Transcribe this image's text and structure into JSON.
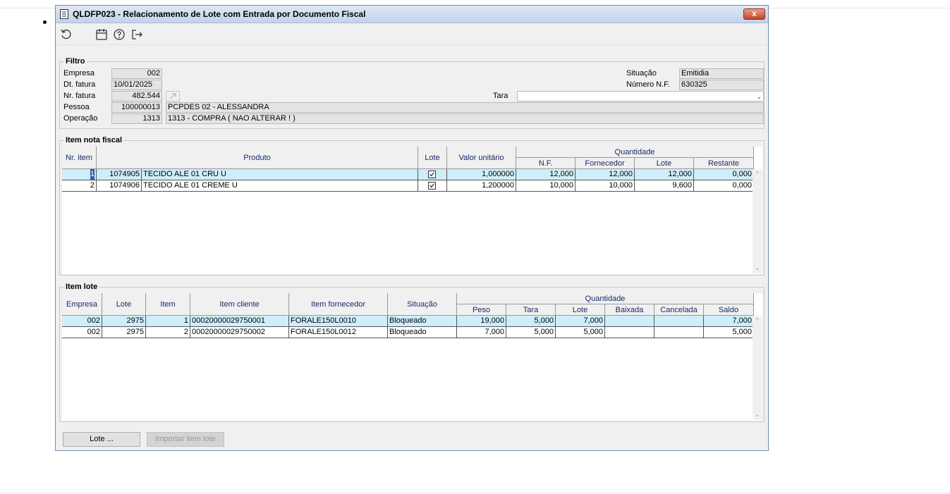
{
  "window": {
    "title": "QLDFP023 - Relacionamento de Lote com Entrada por Documento Fiscal",
    "close_label": "x"
  },
  "toolbar": {
    "icons": [
      "refresh-icon",
      "calendar-icon",
      "help-icon",
      "exit-icon"
    ]
  },
  "filtro": {
    "label": "Filtro",
    "empresa_label": "Empresa",
    "empresa": "002",
    "dt_fatura_label": "Dt. fatura",
    "dt_fatura": "10/01/2025",
    "nr_fatura_label": "Nr. fatura",
    "nr_fatura": "482.544",
    "pessoa_label": "Pessoa",
    "pessoa_code": "100000013",
    "pessoa_name": "PCPDES 02 - ALESSANDRA",
    "operacao_label": "Operação",
    "operacao_code": "1313",
    "operacao_name": "1313 - COMPRA ( NAO ALTERAR ! )",
    "situacao_label": "Situação",
    "situacao": "Emitidia",
    "numero_nf_label": "Número N.F.",
    "numero_nf": "630325",
    "tara_label": "Tara",
    "tara": ""
  },
  "item_nota": {
    "label": "Item nota fiscal",
    "headers": {
      "nr_item": "Nr. item",
      "produto": "Produto",
      "lote": "Lote",
      "valor_unitario": "Valor unitário",
      "quantidade": "Quantidade",
      "nf": "N.F.",
      "fornecedor": "Fornecedor",
      "q_lote": "Lote",
      "restante": "Restante"
    },
    "rows": [
      {
        "nr": "1",
        "cod": "1074905",
        "desc": "TECIDO ALE 01 CRU U",
        "valor": "1,000000",
        "nf": "12,000",
        "fornecedor": "12,000",
        "lote": "12,000",
        "restante": "0,000"
      },
      {
        "nr": "2",
        "cod": "1074906",
        "desc": "TECIDO ALE 01 CREME U",
        "valor": "1,200000",
        "nf": "10,000",
        "fornecedor": "10,000",
        "lote": "9,600",
        "restante": "0,000"
      }
    ]
  },
  "item_lote": {
    "label": "Item lote",
    "headers": {
      "empresa": "Empresa",
      "lote": "Lote",
      "item": "Item",
      "item_cliente": "Item cliente",
      "item_fornecedor": "Item fornecedor",
      "situacao": "Situação",
      "quantidade": "Quantidade",
      "peso": "Peso",
      "tara": "Tara",
      "q_lote": "Lote",
      "baixada": "Baixada",
      "cancelada": "Cancelada",
      "saldo": "Saldo"
    },
    "rows": [
      {
        "empresa": "002",
        "lote": "2975",
        "item": "1",
        "cliente": "00020000029750001",
        "fornecedor": "FORALE150L0010",
        "situacao": "Bloqueado",
        "peso": "19,000",
        "tara": "5,000",
        "lote_q": "7,000",
        "baixada": "",
        "cancelada": "",
        "saldo": "7,000"
      },
      {
        "empresa": "002",
        "lote": "2975",
        "item": "2",
        "cliente": "00020000029750002",
        "fornecedor": "FORALE150L0012",
        "situacao": "Bloqueado",
        "peso": "7,000",
        "tara": "5,000",
        "lote_q": "5,000",
        "baixada": "",
        "cancelada": "",
        "saldo": "5,000"
      }
    ]
  },
  "buttons": {
    "lote": "Lote ...",
    "importar": "Importar item lote"
  }
}
